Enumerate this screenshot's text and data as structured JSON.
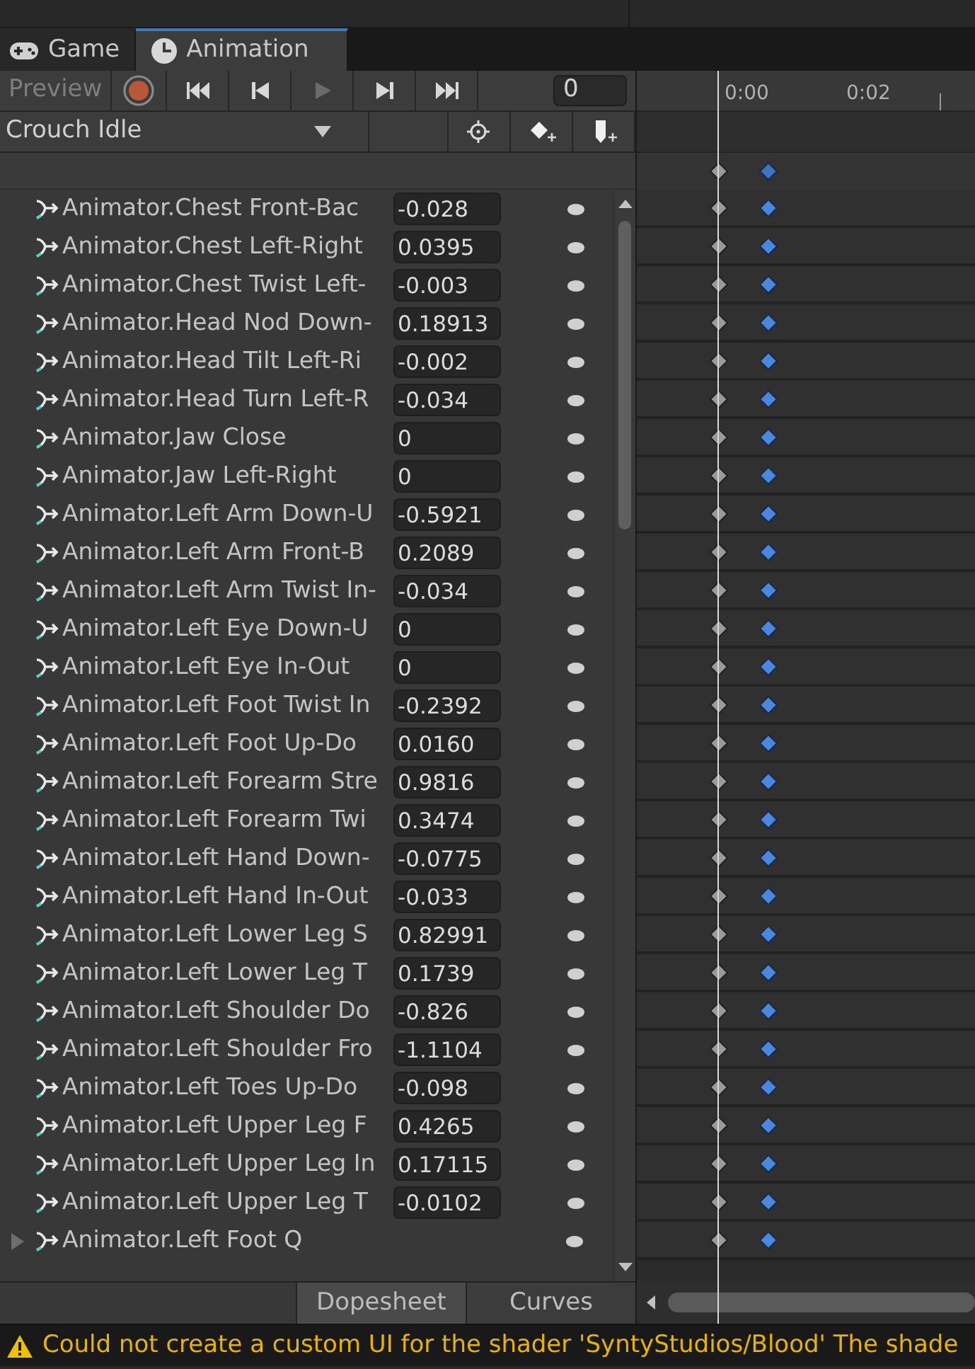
{
  "tabs": [
    {
      "label": "Game",
      "kind": "game",
      "selected": false
    },
    {
      "label": "Animation",
      "kind": "clock",
      "selected": true
    }
  ],
  "toolbar": {
    "preview": {
      "label": "Preview",
      "on": false
    },
    "record": {
      "on": false
    },
    "transport": [
      {
        "kind": "first",
        "disabled": false
      },
      {
        "kind": "prev",
        "disabled": false
      },
      {
        "kind": "play",
        "disabled": true
      },
      {
        "kind": "next",
        "disabled": false
      },
      {
        "kind": "last",
        "disabled": false
      }
    ],
    "frame": "0"
  },
  "clip": {
    "value": "Crouch Idle"
  },
  "timeline": {
    "ticks": [
      "0:00",
      "0:02"
    ]
  },
  "properties": [
    {
      "name": "Animator.Chest Front-Bac",
      "kind": "float",
      "value": "-0.028"
    },
    {
      "name": "Animator.Chest Left-Right",
      "kind": "float",
      "value": "0.0395"
    },
    {
      "name": "Animator.Chest Twist Left-",
      "kind": "float",
      "value": "-0.003"
    },
    {
      "name": "Animator.Head Nod Down-",
      "kind": "float",
      "value": "0.18913"
    },
    {
      "name": "Animator.Head Tilt Left-Ri",
      "kind": "float",
      "value": "-0.002"
    },
    {
      "name": "Animator.Head Turn Left-R",
      "kind": "float",
      "value": "-0.034"
    },
    {
      "name": "Animator.Jaw Close",
      "kind": "float",
      "value": "0"
    },
    {
      "name": "Animator.Jaw Left-Right",
      "kind": "float",
      "value": "0"
    },
    {
      "name": "Animator.Left Arm Down-U",
      "kind": "float",
      "value": "-0.5921"
    },
    {
      "name": "Animator.Left Arm Front-B",
      "kind": "float",
      "value": "0.2089"
    },
    {
      "name": "Animator.Left Arm Twist In-",
      "kind": "float",
      "value": "-0.034"
    },
    {
      "name": "Animator.Left Eye Down-U",
      "kind": "float",
      "value": "0"
    },
    {
      "name": "Animator.Left Eye In-Out",
      "kind": "float",
      "value": "0"
    },
    {
      "name": "Animator.Left Foot Twist In",
      "kind": "float",
      "value": "-0.2392"
    },
    {
      "name": "Animator.Left Foot Up-Do",
      "kind": "float",
      "value": "0.0160"
    },
    {
      "name": "Animator.Left Forearm Stre",
      "kind": "float",
      "value": "0.9816"
    },
    {
      "name": "Animator.Left Forearm Twi",
      "kind": "float",
      "value": "0.3474"
    },
    {
      "name": "Animator.Left Hand Down-",
      "kind": "float",
      "value": "-0.0775"
    },
    {
      "name": "Animator.Left Hand In-Out",
      "kind": "float",
      "value": "-0.033"
    },
    {
      "name": "Animator.Left Lower Leg S",
      "kind": "float",
      "value": "0.82991"
    },
    {
      "name": "Animator.Left Lower Leg T",
      "kind": "float",
      "value": "0.1739"
    },
    {
      "name": "Animator.Left Shoulder Do",
      "kind": "float",
      "value": "-0.826"
    },
    {
      "name": "Animator.Left Shoulder Fro",
      "kind": "float",
      "value": "-1.1104"
    },
    {
      "name": "Animator.Left Toes Up-Do",
      "kind": "float",
      "value": "-0.098"
    },
    {
      "name": "Animator.Left Upper Leg F",
      "kind": "float",
      "value": "0.4265"
    },
    {
      "name": "Animator.Left Upper Leg In",
      "kind": "float",
      "value": "0.17115"
    },
    {
      "name": "Animator.Left Upper Leg T",
      "kind": "float",
      "value": "-0.0102"
    },
    {
      "name": "Animator.Left Foot Q",
      "kind": "group",
      "expanded": false
    }
  ],
  "view_tabs": [
    {
      "label": "Dopesheet",
      "selected": true
    },
    {
      "label": "Curves",
      "selected": false
    }
  ],
  "status": {
    "kind": "warning",
    "message": "Could not create a custom UI for the shader 'SyntyStudios/Blood' The shade"
  }
}
